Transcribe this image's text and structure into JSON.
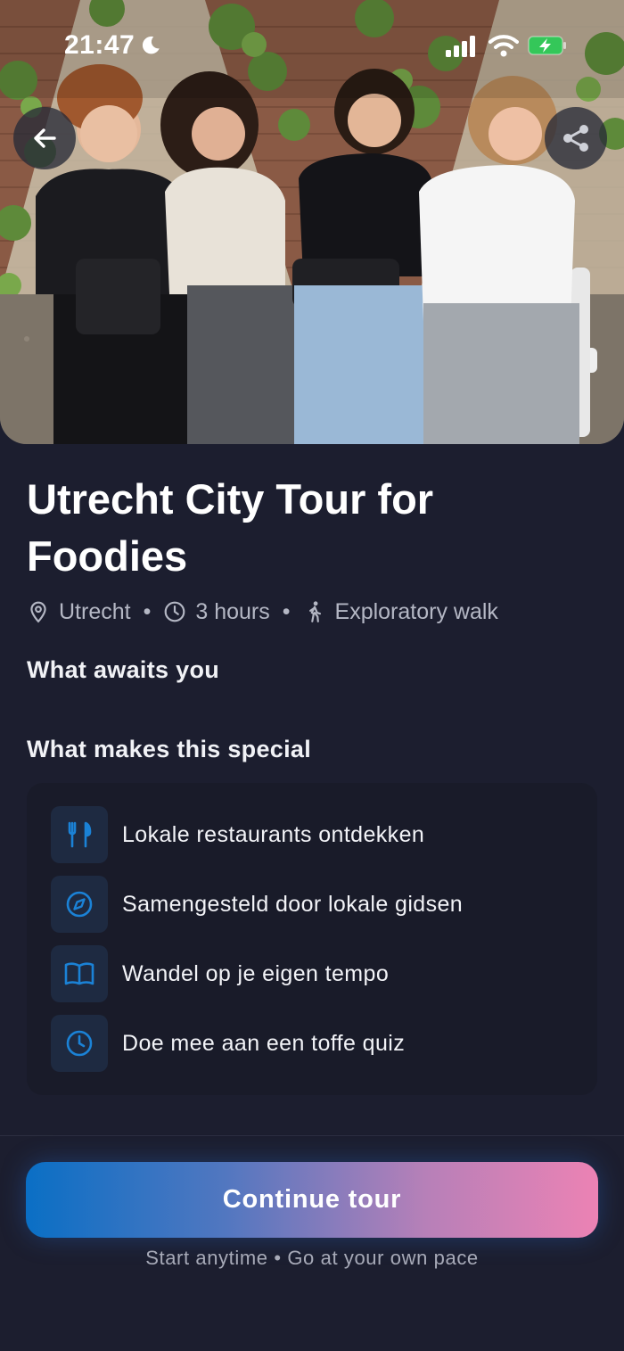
{
  "status_bar": {
    "time": "21:47",
    "icons": [
      "moon-icon",
      "signal-icon",
      "wifi-icon",
      "battery-charging-icon"
    ]
  },
  "hero": {
    "image": "photo of four women sitting on a white bench eating snacks in front of an ivy-covered brick wall",
    "back_icon": "arrow-left-icon",
    "share_icon": "share-icon"
  },
  "tour": {
    "title": "Utrecht City Tour for Foodies",
    "location": "Utrecht",
    "duration": "3 hours",
    "type": "Exploratory walk",
    "separator": "•"
  },
  "sections": {
    "awaits": "What awaits you",
    "special": "What makes this special"
  },
  "features": [
    {
      "icon": "fork-knife-icon",
      "label": "Lokale restaurants ontdekken"
    },
    {
      "icon": "compass-icon",
      "label": "Samengesteld door lokale gidsen"
    },
    {
      "icon": "open-book-icon",
      "label": "Wandel op je eigen tempo"
    },
    {
      "icon": "clock-icon",
      "label": "Doe mee aan een toffe quiz"
    }
  ],
  "cta": {
    "label": "Continue tour",
    "note": "Start anytime • Go at your own pace"
  },
  "colors": {
    "background": "#1c1e2f",
    "card": "#191b29",
    "icon_box": "#1e2a41",
    "icon_accent": "#1b82d6",
    "cta_gradient_start": "#0a6fc5",
    "cta_gradient_end": "#ec82b4",
    "muted_text": "#b4b7c4"
  }
}
